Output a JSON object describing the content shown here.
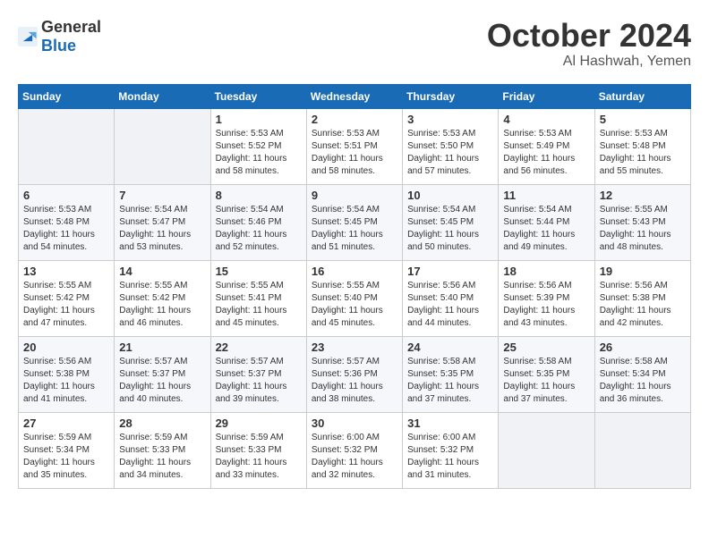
{
  "logo": {
    "general": "General",
    "blue": "Blue"
  },
  "header": {
    "month": "October 2024",
    "location": "Al Hashwah, Yemen"
  },
  "weekdays": [
    "Sunday",
    "Monday",
    "Tuesday",
    "Wednesday",
    "Thursday",
    "Friday",
    "Saturday"
  ],
  "weeks": [
    [
      {
        "day": "",
        "sunrise": "",
        "sunset": "",
        "daylight": ""
      },
      {
        "day": "",
        "sunrise": "",
        "sunset": "",
        "daylight": ""
      },
      {
        "day": "1",
        "sunrise": "Sunrise: 5:53 AM",
        "sunset": "Sunset: 5:52 PM",
        "daylight": "Daylight: 11 hours and 58 minutes."
      },
      {
        "day": "2",
        "sunrise": "Sunrise: 5:53 AM",
        "sunset": "Sunset: 5:51 PM",
        "daylight": "Daylight: 11 hours and 58 minutes."
      },
      {
        "day": "3",
        "sunrise": "Sunrise: 5:53 AM",
        "sunset": "Sunset: 5:50 PM",
        "daylight": "Daylight: 11 hours and 57 minutes."
      },
      {
        "day": "4",
        "sunrise": "Sunrise: 5:53 AM",
        "sunset": "Sunset: 5:49 PM",
        "daylight": "Daylight: 11 hours and 56 minutes."
      },
      {
        "day": "5",
        "sunrise": "Sunrise: 5:53 AM",
        "sunset": "Sunset: 5:48 PM",
        "daylight": "Daylight: 11 hours and 55 minutes."
      }
    ],
    [
      {
        "day": "6",
        "sunrise": "Sunrise: 5:53 AM",
        "sunset": "Sunset: 5:48 PM",
        "daylight": "Daylight: 11 hours and 54 minutes."
      },
      {
        "day": "7",
        "sunrise": "Sunrise: 5:54 AM",
        "sunset": "Sunset: 5:47 PM",
        "daylight": "Daylight: 11 hours and 53 minutes."
      },
      {
        "day": "8",
        "sunrise": "Sunrise: 5:54 AM",
        "sunset": "Sunset: 5:46 PM",
        "daylight": "Daylight: 11 hours and 52 minutes."
      },
      {
        "day": "9",
        "sunrise": "Sunrise: 5:54 AM",
        "sunset": "Sunset: 5:45 PM",
        "daylight": "Daylight: 11 hours and 51 minutes."
      },
      {
        "day": "10",
        "sunrise": "Sunrise: 5:54 AM",
        "sunset": "Sunset: 5:45 PM",
        "daylight": "Daylight: 11 hours and 50 minutes."
      },
      {
        "day": "11",
        "sunrise": "Sunrise: 5:54 AM",
        "sunset": "Sunset: 5:44 PM",
        "daylight": "Daylight: 11 hours and 49 minutes."
      },
      {
        "day": "12",
        "sunrise": "Sunrise: 5:55 AM",
        "sunset": "Sunset: 5:43 PM",
        "daylight": "Daylight: 11 hours and 48 minutes."
      }
    ],
    [
      {
        "day": "13",
        "sunrise": "Sunrise: 5:55 AM",
        "sunset": "Sunset: 5:42 PM",
        "daylight": "Daylight: 11 hours and 47 minutes."
      },
      {
        "day": "14",
        "sunrise": "Sunrise: 5:55 AM",
        "sunset": "Sunset: 5:42 PM",
        "daylight": "Daylight: 11 hours and 46 minutes."
      },
      {
        "day": "15",
        "sunrise": "Sunrise: 5:55 AM",
        "sunset": "Sunset: 5:41 PM",
        "daylight": "Daylight: 11 hours and 45 minutes."
      },
      {
        "day": "16",
        "sunrise": "Sunrise: 5:55 AM",
        "sunset": "Sunset: 5:40 PM",
        "daylight": "Daylight: 11 hours and 45 minutes."
      },
      {
        "day": "17",
        "sunrise": "Sunrise: 5:56 AM",
        "sunset": "Sunset: 5:40 PM",
        "daylight": "Daylight: 11 hours and 44 minutes."
      },
      {
        "day": "18",
        "sunrise": "Sunrise: 5:56 AM",
        "sunset": "Sunset: 5:39 PM",
        "daylight": "Daylight: 11 hours and 43 minutes."
      },
      {
        "day": "19",
        "sunrise": "Sunrise: 5:56 AM",
        "sunset": "Sunset: 5:38 PM",
        "daylight": "Daylight: 11 hours and 42 minutes."
      }
    ],
    [
      {
        "day": "20",
        "sunrise": "Sunrise: 5:56 AM",
        "sunset": "Sunset: 5:38 PM",
        "daylight": "Daylight: 11 hours and 41 minutes."
      },
      {
        "day": "21",
        "sunrise": "Sunrise: 5:57 AM",
        "sunset": "Sunset: 5:37 PM",
        "daylight": "Daylight: 11 hours and 40 minutes."
      },
      {
        "day": "22",
        "sunrise": "Sunrise: 5:57 AM",
        "sunset": "Sunset: 5:37 PM",
        "daylight": "Daylight: 11 hours and 39 minutes."
      },
      {
        "day": "23",
        "sunrise": "Sunrise: 5:57 AM",
        "sunset": "Sunset: 5:36 PM",
        "daylight": "Daylight: 11 hours and 38 minutes."
      },
      {
        "day": "24",
        "sunrise": "Sunrise: 5:58 AM",
        "sunset": "Sunset: 5:35 PM",
        "daylight": "Daylight: 11 hours and 37 minutes."
      },
      {
        "day": "25",
        "sunrise": "Sunrise: 5:58 AM",
        "sunset": "Sunset: 5:35 PM",
        "daylight": "Daylight: 11 hours and 37 minutes."
      },
      {
        "day": "26",
        "sunrise": "Sunrise: 5:58 AM",
        "sunset": "Sunset: 5:34 PM",
        "daylight": "Daylight: 11 hours and 36 minutes."
      }
    ],
    [
      {
        "day": "27",
        "sunrise": "Sunrise: 5:59 AM",
        "sunset": "Sunset: 5:34 PM",
        "daylight": "Daylight: 11 hours and 35 minutes."
      },
      {
        "day": "28",
        "sunrise": "Sunrise: 5:59 AM",
        "sunset": "Sunset: 5:33 PM",
        "daylight": "Daylight: 11 hours and 34 minutes."
      },
      {
        "day": "29",
        "sunrise": "Sunrise: 5:59 AM",
        "sunset": "Sunset: 5:33 PM",
        "daylight": "Daylight: 11 hours and 33 minutes."
      },
      {
        "day": "30",
        "sunrise": "Sunrise: 6:00 AM",
        "sunset": "Sunset: 5:32 PM",
        "daylight": "Daylight: 11 hours and 32 minutes."
      },
      {
        "day": "31",
        "sunrise": "Sunrise: 6:00 AM",
        "sunset": "Sunset: 5:32 PM",
        "daylight": "Daylight: 11 hours and 31 minutes."
      },
      {
        "day": "",
        "sunrise": "",
        "sunset": "",
        "daylight": ""
      },
      {
        "day": "",
        "sunrise": "",
        "sunset": "",
        "daylight": ""
      }
    ]
  ]
}
